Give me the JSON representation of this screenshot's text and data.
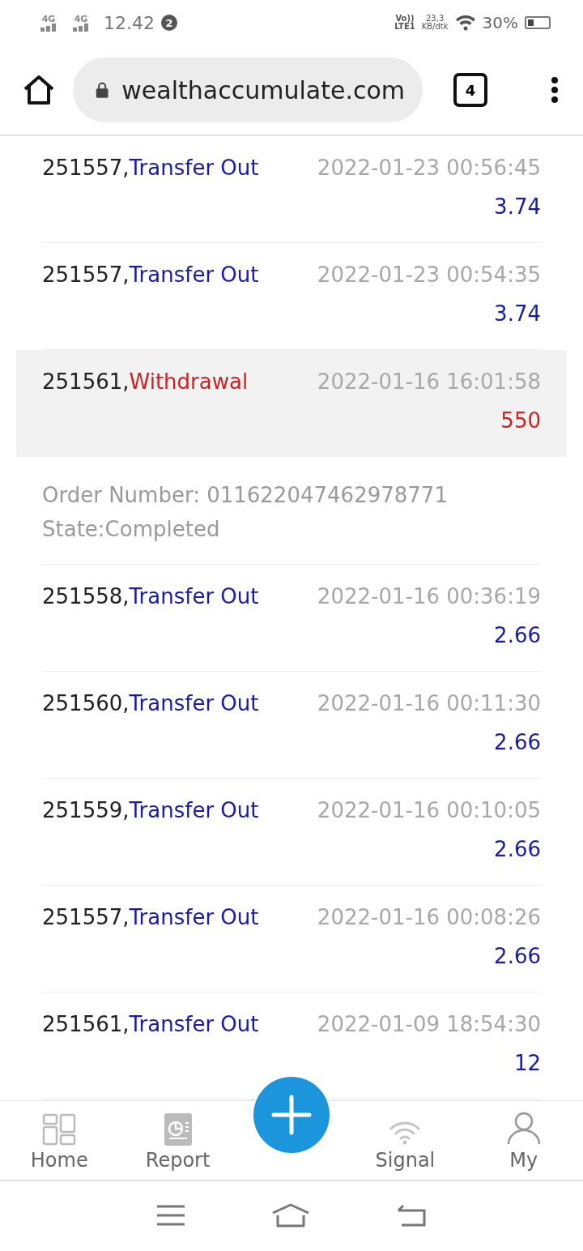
{
  "status_bar": {
    "networks": [
      "4G",
      "4G"
    ],
    "time": "12.42",
    "notification_count": "2",
    "volte": [
      "Vo))",
      "LTE1"
    ],
    "speed": [
      "23,3",
      "KB/dtk"
    ],
    "battery": "30%"
  },
  "browser": {
    "url": "wealthaccumulate.com",
    "tab_count": "4"
  },
  "records": [
    {
      "id": "251557,",
      "type": "Transfer Out",
      "kind": "transfer",
      "time": "2022-01-23 00:56:45",
      "amount": "3.74",
      "expanded": false
    },
    {
      "id": "251557,",
      "type": "Transfer Out",
      "kind": "transfer",
      "time": "2022-01-23 00:54:35",
      "amount": "3.74",
      "expanded": false
    },
    {
      "id": "251561,",
      "type": "Withdrawal",
      "kind": "withdrawal",
      "time": "2022-01-16 16:01:58",
      "amount": "550",
      "expanded": true,
      "details": [
        "Order Number: 011622047462978771",
        "State:Completed"
      ]
    },
    {
      "id": "251558,",
      "type": "Transfer Out",
      "kind": "transfer",
      "time": "2022-01-16 00:36:19",
      "amount": "2.66",
      "expanded": false
    },
    {
      "id": "251560,",
      "type": "Transfer Out",
      "kind": "transfer",
      "time": "2022-01-16 00:11:30",
      "amount": "2.66",
      "expanded": false
    },
    {
      "id": "251559,",
      "type": "Transfer Out",
      "kind": "transfer",
      "time": "2022-01-16 00:10:05",
      "amount": "2.66",
      "expanded": false
    },
    {
      "id": "251557,",
      "type": "Transfer Out",
      "kind": "transfer",
      "time": "2022-01-16 00:08:26",
      "amount": "2.66",
      "expanded": false
    },
    {
      "id": "251561,",
      "type": "Transfer Out",
      "kind": "transfer",
      "time": "2022-01-09 18:54:30",
      "amount": "12",
      "expanded": false
    }
  ],
  "bottom_nav": [
    {
      "label": "Home",
      "kind": "home"
    },
    {
      "label": "Report",
      "kind": "report"
    },
    {
      "kind": "add"
    },
    {
      "label": "Signal",
      "kind": "signal"
    },
    {
      "label": "My",
      "kind": "my"
    }
  ]
}
